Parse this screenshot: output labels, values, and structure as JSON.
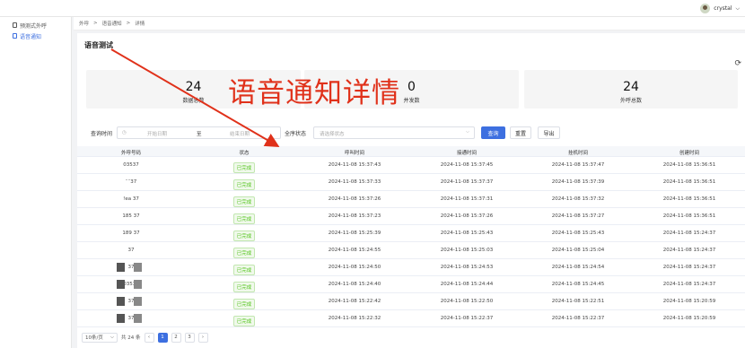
{
  "header": {
    "username": "crystal",
    "dropdown_icon": "chevron-down-icon"
  },
  "sidebar": {
    "items": [
      {
        "label": "预测式外呼",
        "active": false
      },
      {
        "label": "语音通知",
        "active": true
      }
    ]
  },
  "breadcrumb": [
    "外呼",
    ">",
    "语音通知",
    ">",
    "详情"
  ],
  "page": {
    "title": "语音测试",
    "refresh_icon": "refresh-icon"
  },
  "stats": [
    {
      "value": "24",
      "label": "数据总数"
    },
    {
      "value": "0",
      "label": "并发数"
    },
    {
      "value": "24",
      "label": "外呼总数"
    }
  ],
  "filter": {
    "time_label": "查询时间",
    "start_placeholder": "开始日期",
    "range_sep": "至",
    "end_placeholder": "结束日期",
    "status_label": "全序状态",
    "status_placeholder": "请选择状态",
    "query_button": "查询",
    "reset_button": "重置",
    "export_button": "导出"
  },
  "table": {
    "columns": [
      "外呼号码",
      "状态",
      "呼叫时间",
      "接通时间",
      "挂机时间",
      "创建时间"
    ],
    "rows": [
      {
        "phone": "03537",
        "status": "已完成",
        "call": "2024-11-08 15:37:43",
        "connect": "2024-11-08 15:37:45",
        "hangup": "2024-11-08 15:37:47",
        "created": "2024-11-08 15:36:51"
      },
      {
        "phone": "¨¨37",
        "status": "已完成",
        "call": "2024-11-08 15:37:33",
        "connect": "2024-11-08 15:37:37",
        "hangup": "2024-11-08 15:37:39",
        "created": "2024-11-08 15:36:51"
      },
      {
        "phone": "!ea 37",
        "status": "已完成",
        "call": "2024-11-08 15:37:26",
        "connect": "2024-11-08 15:37:31",
        "hangup": "2024-11-08 15:37:32",
        "created": "2024-11-08 15:36:51"
      },
      {
        "phone": "185 37",
        "status": "已完成",
        "call": "2024-11-08 15:37:23",
        "connect": "2024-11-08 15:37:26",
        "hangup": "2024-11-08 15:37:27",
        "created": "2024-11-08 15:36:51"
      },
      {
        "phone": "189 37",
        "status": "已完成",
        "call": "2024-11-08 15:25:39",
        "connect": "2024-11-08 15:25:43",
        "hangup": "2024-11-08 15:25:43",
        "created": "2024-11-08 15:24:37"
      },
      {
        "phone": "37",
        "status": "已完成",
        "call": "2024-11-08 15:24:55",
        "connect": "2024-11-08 15:25:03",
        "hangup": "2024-11-08 15:25:04",
        "created": "2024-11-08 15:24:37"
      },
      {
        "phone": "37",
        "status": "已完成",
        "call": "2024-11-08 15:24:50",
        "connect": "2024-11-08 15:24:53",
        "hangup": "2024-11-08 15:24:54",
        "created": "2024-11-08 15:24:37"
      },
      {
        "phone": "03537",
        "status": "已完成",
        "call": "2024-11-08 15:24:40",
        "connect": "2024-11-08 15:24:44",
        "hangup": "2024-11-08 15:24:45",
        "created": "2024-11-08 15:24:37"
      },
      {
        "phone": "37",
        "status": "已完成",
        "call": "2024-11-08 15:22:42",
        "connect": "2024-11-08 15:22:50",
        "hangup": "2024-11-08 15:22:51",
        "created": "2024-11-08 15:20:59"
      },
      {
        "phone": "37",
        "status": "已完成",
        "call": "2024-11-08 15:22:32",
        "connect": "2024-11-08 15:22:37",
        "hangup": "2024-11-08 15:22:37",
        "created": "2024-11-08 15:20:59"
      }
    ]
  },
  "pagination": {
    "page_size": "10条/页",
    "total": "共 24 条",
    "pages": [
      "1",
      "2",
      "3"
    ],
    "current": "1"
  },
  "annotation": {
    "text": "语音通知详情",
    "color": "#e0311a"
  },
  "colors": {
    "primary": "#3d6fe0",
    "success": "#52c41a"
  }
}
